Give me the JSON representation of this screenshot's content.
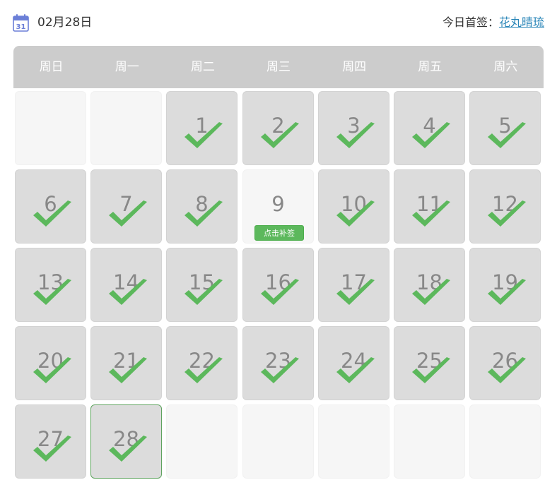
{
  "header": {
    "date": "02月28日",
    "first_sign_label": "今日首签：",
    "first_sign_user": "花丸晴琉"
  },
  "weekdays": [
    "周日",
    "周一",
    "周二",
    "周三",
    "周四",
    "周五",
    "周六"
  ],
  "makeup_label": "点击补签",
  "calendar": {
    "leading_empty": 2,
    "days_in_month": 28,
    "trailing_empty": 5,
    "signed_days": [
      1,
      2,
      3,
      4,
      5,
      6,
      7,
      8,
      10,
      11,
      12,
      13,
      14,
      15,
      16,
      17,
      18,
      19,
      20,
      21,
      22,
      23,
      24,
      25,
      26,
      27,
      28
    ],
    "missed_days": [
      9
    ],
    "today": 28
  },
  "colors": {
    "check": "#5cb85c",
    "signed_bg": "#dcdcdc",
    "empty_bg": "#f6f6f6",
    "header_bar": "#cccccc",
    "link": "#2a86b8",
    "today_border": "#5fa35f"
  }
}
